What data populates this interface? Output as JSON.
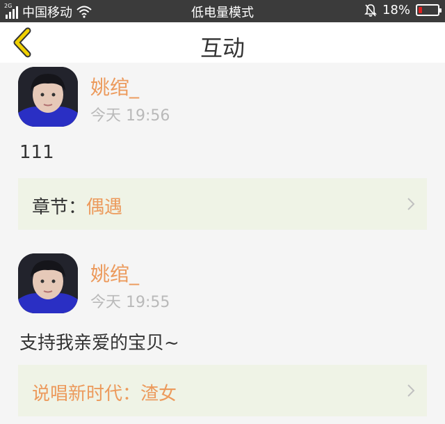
{
  "status_bar": {
    "network_tag": "2G",
    "carrier": "中国移动",
    "mode": "低电量模式",
    "battery": "18%",
    "battery_level": 0.18
  },
  "header": {
    "title": "互动"
  },
  "posts": [
    {
      "username": "姚绾_",
      "time": "今天 19:56",
      "content": "111",
      "chapter_label": "章节：",
      "chapter_name": "偶遇"
    },
    {
      "username": "姚绾_",
      "time": "今天 19:55",
      "content": "支持我亲爱的宝贝~",
      "chapter_label": "",
      "chapter_name": "说唱新时代：渣女"
    }
  ],
  "colors": {
    "accent": "#ec9a5c",
    "status_bar": "#3b3b3b",
    "card": "#eff3e6",
    "back_arrow": "#f0d000"
  }
}
